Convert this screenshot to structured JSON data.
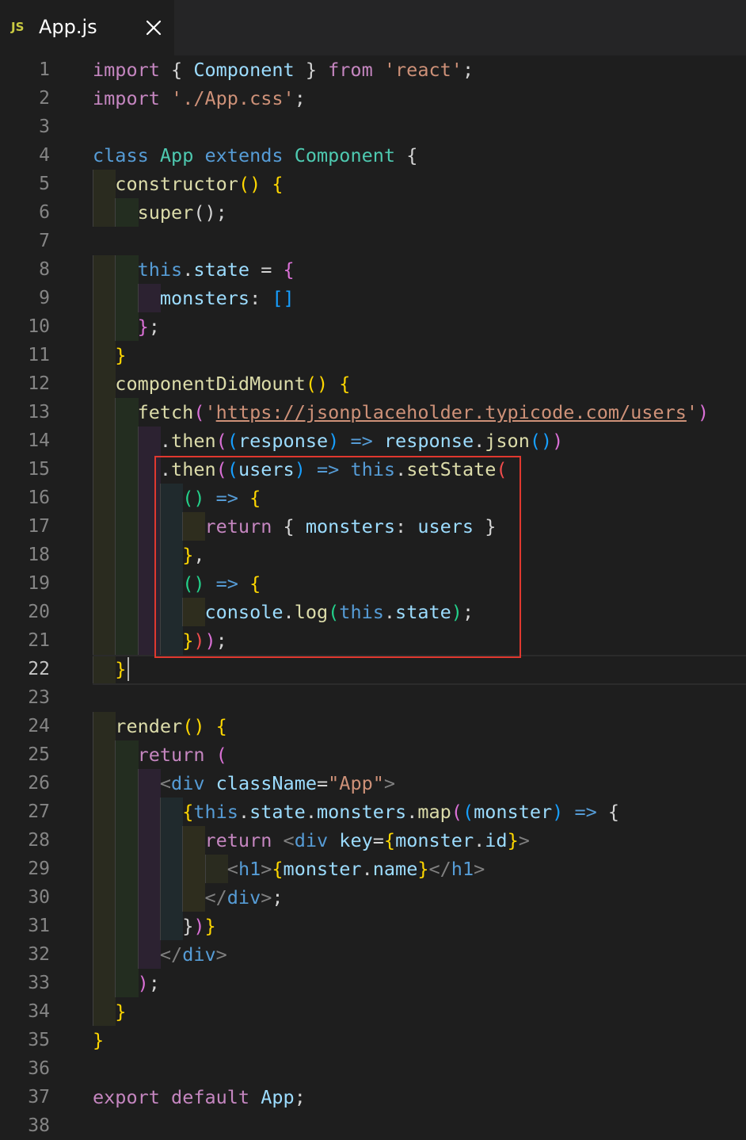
{
  "tab": {
    "file_badge": "JS",
    "file_name": "App.js",
    "close_glyph": "close-icon"
  },
  "editor": {
    "current_line": 22,
    "lines": [
      {
        "n": 1,
        "tokens": [
          [
            "import",
            "#c586c0"
          ],
          [
            " { ",
            "#d4d4d4"
          ],
          [
            "Component",
            "#9cdcfe"
          ],
          [
            " } ",
            "#d4d4d4"
          ],
          [
            "from",
            "#c586c0"
          ],
          [
            " ",
            "#d4d4d4"
          ],
          [
            "'react'",
            "#ce9178"
          ],
          [
            ";",
            "#d4d4d4"
          ]
        ]
      },
      {
        "n": 2,
        "tokens": [
          [
            "import",
            "#c586c0"
          ],
          [
            " ",
            "#d4d4d4"
          ],
          [
            "'./App.css'",
            "#ce9178"
          ],
          [
            ";",
            "#d4d4d4"
          ]
        ]
      },
      {
        "n": 3,
        "tokens": []
      },
      {
        "n": 4,
        "tokens": [
          [
            "class",
            "#569cd6"
          ],
          [
            " ",
            "#d4d4d4"
          ],
          [
            "App",
            "#4ec9b0"
          ],
          [
            " ",
            "#d4d4d4"
          ],
          [
            "extends",
            "#569cd6"
          ],
          [
            " ",
            "#d4d4d4"
          ],
          [
            "Component",
            "#4ec9b0"
          ],
          [
            " {",
            "#d4d4d4"
          ]
        ]
      },
      {
        "n": 5,
        "tokens": [
          [
            "  ",
            "#d4d4d4"
          ],
          [
            "constructor",
            "#dcdcaa"
          ],
          [
            "() {",
            "#ffd700"
          ]
        ]
      },
      {
        "n": 6,
        "tokens": [
          [
            "    ",
            "#d4d4d4"
          ],
          [
            "super",
            "#dcdcaa"
          ],
          [
            "();",
            "#d4d4d4"
          ]
        ]
      },
      {
        "n": 7,
        "tokens": []
      },
      {
        "n": 8,
        "tokens": [
          [
            "    ",
            "#d4d4d4"
          ],
          [
            "this",
            "#569cd6"
          ],
          [
            ".",
            "#d4d4d4"
          ],
          [
            "state",
            "#9cdcfe"
          ],
          [
            " = ",
            "#d4d4d4"
          ],
          [
            "{",
            "#da70d6"
          ]
        ]
      },
      {
        "n": 9,
        "tokens": [
          [
            "      ",
            "#d4d4d4"
          ],
          [
            "monsters",
            "#9cdcfe"
          ],
          [
            ": ",
            "#d4d4d4"
          ],
          [
            "[]",
            "#179fff"
          ]
        ]
      },
      {
        "n": 10,
        "tokens": [
          [
            "    ",
            "#d4d4d4"
          ],
          [
            "}",
            "#da70d6"
          ],
          [
            ";",
            "#d4d4d4"
          ]
        ]
      },
      {
        "n": 11,
        "tokens": [
          [
            "  ",
            "#d4d4d4"
          ],
          [
            "}",
            "#ffd700"
          ]
        ]
      },
      {
        "n": 12,
        "tokens": [
          [
            "  ",
            "#d4d4d4"
          ],
          [
            "componentDidMount",
            "#dcdcaa"
          ],
          [
            "() {",
            "#ffd700"
          ]
        ]
      },
      {
        "n": 13,
        "tokens": [
          [
            "    ",
            "#d4d4d4"
          ],
          [
            "fetch",
            "#dcdcaa"
          ],
          [
            "(",
            "#da70d6"
          ],
          [
            "'",
            "#ce9178"
          ],
          [
            "https://jsonplaceholder.typicode.com/users",
            "#ce9178",
            "url"
          ],
          [
            "'",
            "#ce9178"
          ],
          [
            ")",
            "#da70d6"
          ]
        ]
      },
      {
        "n": 14,
        "tokens": [
          [
            "      .",
            "#d4d4d4"
          ],
          [
            "then",
            "#dcdcaa"
          ],
          [
            "(",
            "#da70d6"
          ],
          [
            "(",
            "#179fff"
          ],
          [
            "response",
            "#9cdcfe"
          ],
          [
            ")",
            "#179fff"
          ],
          [
            " ",
            "#d4d4d4"
          ],
          [
            "=>",
            "#569cd6"
          ],
          [
            " ",
            "#d4d4d4"
          ],
          [
            "response",
            "#9cdcfe"
          ],
          [
            ".",
            "#d4d4d4"
          ],
          [
            "json",
            "#dcdcaa"
          ],
          [
            "()",
            "#179fff"
          ],
          [
            ")",
            "#da70d6"
          ]
        ]
      },
      {
        "n": 15,
        "tokens": [
          [
            "      .",
            "#d4d4d4"
          ],
          [
            "then",
            "#dcdcaa"
          ],
          [
            "(",
            "#da70d6"
          ],
          [
            "(",
            "#179fff"
          ],
          [
            "users",
            "#9cdcfe"
          ],
          [
            ")",
            "#179fff"
          ],
          [
            " ",
            "#d4d4d4"
          ],
          [
            "=>",
            "#569cd6"
          ],
          [
            " ",
            "#d4d4d4"
          ],
          [
            "this",
            "#569cd6"
          ],
          [
            ".",
            "#d4d4d4"
          ],
          [
            "setState",
            "#dcdcaa"
          ],
          [
            "(",
            "#f14c4c"
          ]
        ]
      },
      {
        "n": 16,
        "tokens": [
          [
            "        ",
            "#d4d4d4"
          ],
          [
            "()",
            "#23d18b"
          ],
          [
            " ",
            "#d4d4d4"
          ],
          [
            "=>",
            "#569cd6"
          ],
          [
            " ",
            "#d4d4d4"
          ],
          [
            "{",
            "#ffd700"
          ]
        ]
      },
      {
        "n": 17,
        "tokens": [
          [
            "          ",
            "#d4d4d4"
          ],
          [
            "return",
            "#c586c0"
          ],
          [
            " { ",
            "#d4d4d4"
          ],
          [
            "monsters",
            "#9cdcfe"
          ],
          [
            ": ",
            "#d4d4d4"
          ],
          [
            "users",
            "#9cdcfe"
          ],
          [
            " }",
            "#d4d4d4"
          ]
        ]
      },
      {
        "n": 18,
        "tokens": [
          [
            "        ",
            "#d4d4d4"
          ],
          [
            "}",
            "#ffd700"
          ],
          [
            ",",
            "#d4d4d4"
          ]
        ]
      },
      {
        "n": 19,
        "tokens": [
          [
            "        ",
            "#d4d4d4"
          ],
          [
            "()",
            "#23d18b"
          ],
          [
            " ",
            "#d4d4d4"
          ],
          [
            "=>",
            "#569cd6"
          ],
          [
            " ",
            "#d4d4d4"
          ],
          [
            "{",
            "#ffd700"
          ]
        ]
      },
      {
        "n": 20,
        "tokens": [
          [
            "          ",
            "#d4d4d4"
          ],
          [
            "console",
            "#9cdcfe"
          ],
          [
            ".",
            "#d4d4d4"
          ],
          [
            "log",
            "#dcdcaa"
          ],
          [
            "(",
            "#23d18b"
          ],
          [
            "this",
            "#569cd6"
          ],
          [
            ".",
            "#d4d4d4"
          ],
          [
            "state",
            "#9cdcfe"
          ],
          [
            ")",
            "#23d18b"
          ],
          [
            ";",
            "#d4d4d4"
          ]
        ]
      },
      {
        "n": 21,
        "tokens": [
          [
            "        ",
            "#d4d4d4"
          ],
          [
            "}",
            "#ffd700"
          ],
          [
            ")",
            "#f14c4c"
          ],
          [
            ")",
            "#da70d6"
          ],
          [
            ";",
            "#d4d4d4"
          ]
        ]
      },
      {
        "n": 22,
        "tokens": [
          [
            "  ",
            "#d4d4d4"
          ],
          [
            "}",
            "#ffd700"
          ]
        ]
      },
      {
        "n": 23,
        "tokens": []
      },
      {
        "n": 24,
        "tokens": [
          [
            "  ",
            "#d4d4d4"
          ],
          [
            "render",
            "#dcdcaa"
          ],
          [
            "() {",
            "#ffd700"
          ]
        ]
      },
      {
        "n": 25,
        "tokens": [
          [
            "    ",
            "#d4d4d4"
          ],
          [
            "return",
            "#c586c0"
          ],
          [
            " ",
            "#d4d4d4"
          ],
          [
            "(",
            "#da70d6"
          ]
        ]
      },
      {
        "n": 26,
        "tokens": [
          [
            "      ",
            "#d4d4d4"
          ],
          [
            "<",
            "#808080"
          ],
          [
            "div",
            "#569cd6"
          ],
          [
            " ",
            "#d4d4d4"
          ],
          [
            "className",
            "#9cdcfe"
          ],
          [
            "=",
            "#d4d4d4"
          ],
          [
            "\"App\"",
            "#ce9178"
          ],
          [
            ">",
            "#808080"
          ]
        ]
      },
      {
        "n": 27,
        "tokens": [
          [
            "        ",
            "#d4d4d4"
          ],
          [
            "{",
            "#ffd700"
          ],
          [
            "this",
            "#569cd6"
          ],
          [
            ".",
            "#d4d4d4"
          ],
          [
            "state",
            "#9cdcfe"
          ],
          [
            ".",
            "#d4d4d4"
          ],
          [
            "monsters",
            "#9cdcfe"
          ],
          [
            ".",
            "#d4d4d4"
          ],
          [
            "map",
            "#dcdcaa"
          ],
          [
            "(",
            "#da70d6"
          ],
          [
            "(",
            "#179fff"
          ],
          [
            "monster",
            "#9cdcfe"
          ],
          [
            ")",
            "#179fff"
          ],
          [
            " ",
            "#d4d4d4"
          ],
          [
            "=>",
            "#569cd6"
          ],
          [
            " {",
            "#d4d4d4"
          ]
        ]
      },
      {
        "n": 28,
        "tokens": [
          [
            "          ",
            "#d4d4d4"
          ],
          [
            "return",
            "#c586c0"
          ],
          [
            " ",
            "#d4d4d4"
          ],
          [
            "<",
            "#808080"
          ],
          [
            "div",
            "#569cd6"
          ],
          [
            " ",
            "#d4d4d4"
          ],
          [
            "key",
            "#9cdcfe"
          ],
          [
            "=",
            "#d4d4d4"
          ],
          [
            "{",
            "#ffd700"
          ],
          [
            "monster",
            "#9cdcfe"
          ],
          [
            ".",
            "#d4d4d4"
          ],
          [
            "id",
            "#9cdcfe"
          ],
          [
            "}",
            "#ffd700"
          ],
          [
            ">",
            "#808080"
          ]
        ]
      },
      {
        "n": 29,
        "tokens": [
          [
            "            ",
            "#d4d4d4"
          ],
          [
            "<",
            "#808080"
          ],
          [
            "h1",
            "#569cd6"
          ],
          [
            ">",
            "#808080"
          ],
          [
            "{",
            "#ffd700"
          ],
          [
            "monster",
            "#9cdcfe"
          ],
          [
            ".",
            "#d4d4d4"
          ],
          [
            "name",
            "#9cdcfe"
          ],
          [
            "}",
            "#ffd700"
          ],
          [
            "</",
            "#808080"
          ],
          [
            "h1",
            "#569cd6"
          ],
          [
            ">",
            "#808080"
          ]
        ]
      },
      {
        "n": 30,
        "tokens": [
          [
            "          ",
            "#d4d4d4"
          ],
          [
            "</",
            "#808080"
          ],
          [
            "div",
            "#569cd6"
          ],
          [
            ">",
            "#808080"
          ],
          [
            ";",
            "#d4d4d4"
          ]
        ]
      },
      {
        "n": 31,
        "tokens": [
          [
            "        ",
            "#d4d4d4"
          ],
          [
            "}",
            "#d4d4d4"
          ],
          [
            ")",
            "#da70d6"
          ],
          [
            "}",
            "#ffd700"
          ]
        ]
      },
      {
        "n": 32,
        "tokens": [
          [
            "      ",
            "#d4d4d4"
          ],
          [
            "</",
            "#808080"
          ],
          [
            "div",
            "#569cd6"
          ],
          [
            ">",
            "#808080"
          ]
        ]
      },
      {
        "n": 33,
        "tokens": [
          [
            "    ",
            "#d4d4d4"
          ],
          [
            ")",
            "#da70d6"
          ],
          [
            ";",
            "#d4d4d4"
          ]
        ]
      },
      {
        "n": 34,
        "tokens": [
          [
            "  ",
            "#d4d4d4"
          ],
          [
            "}",
            "#ffd700"
          ]
        ]
      },
      {
        "n": 35,
        "tokens": [
          [
            "}",
            "#ffd700"
          ]
        ]
      },
      {
        "n": 36,
        "tokens": []
      },
      {
        "n": 37,
        "tokens": [
          [
            "export",
            "#c586c0"
          ],
          [
            " ",
            "#d4d4d4"
          ],
          [
            "default",
            "#c586c0"
          ],
          [
            " ",
            "#d4d4d4"
          ],
          [
            "App",
            "#9cdcfe"
          ],
          [
            ";",
            "#d4d4d4"
          ]
        ]
      },
      {
        "n": 38,
        "tokens": []
      }
    ]
  },
  "colors": {
    "editor_background": "#1e1e1e",
    "tab_bar_background": "#252526",
    "line_number": "#858585",
    "highlight_box": "#e0382f"
  }
}
